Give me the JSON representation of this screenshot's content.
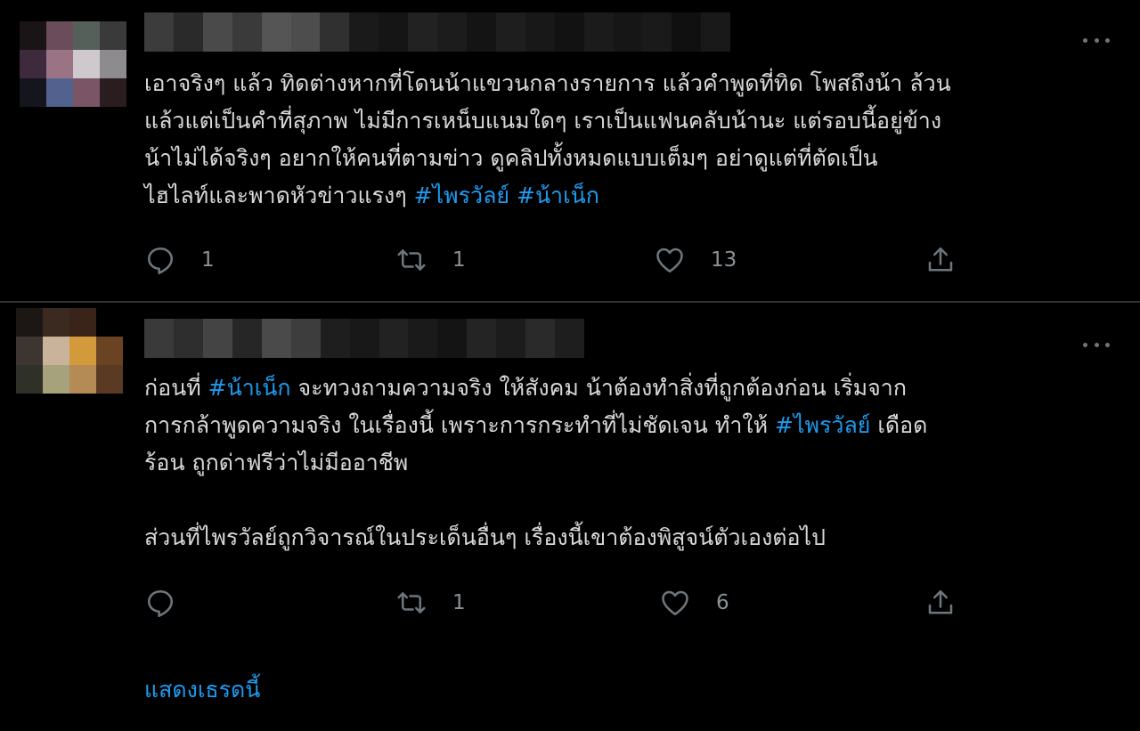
{
  "tweets": [
    {
      "lines": [
        [
          {
            "t": "เอาจริงๆ แล้ว ทิดต่างหากที่โดนน้าแขวนกลางรายการ แล้วคำพูดที่ทิด โพสถึงน้า ล้วน"
          }
        ],
        [
          {
            "t": "แล้วแต่เป็นคำที่สุภาพ ไม่มีการเหน็บแนมใดๆ เราเป็นแฟนคลับน้านะ แต่รอบนี้อยู่ข้าง"
          }
        ],
        [
          {
            "t": "น้าไม่ได้จริงๆ อยากให้คนที่ตามข่าว ดูคลิปทั้งหมดแบบเต็มๆ อย่าดูแต่ที่ตัดเป็น"
          }
        ],
        [
          {
            "t": "ไฮไลท์และพาดหัวข่าวแรงๆ "
          },
          {
            "t": "#ไพรวัลย์",
            "tag": true
          },
          {
            "t": " "
          },
          {
            "t": "#น้าเน็ก",
            "tag": true
          }
        ]
      ],
      "reply_count": "1",
      "retweet_count": "1",
      "like_count": "13"
    },
    {
      "lines": [
        [
          {
            "t": "ก่อนที่ "
          },
          {
            "t": "#น้าเน็ก",
            "tag": true
          },
          {
            "t": " จะทวงถามความจริง ให้สังคม น้าต้องทำสิ่งที่ถูกต้องก่อน เริ่มจาก"
          }
        ],
        [
          {
            "t": "การกล้าพูดความจริง ในเรื่องนี้  เพราะการกระทำที่ไม่ชัดเจน ทำให้ "
          },
          {
            "t": "#ไพรวัลย์",
            "tag": true
          },
          {
            "t": " เดือด"
          }
        ],
        [
          {
            "t": "ร้อน ถูกด่าฟรีว่าไม่มีออาชีพ"
          }
        ],
        [],
        [
          {
            "t": "ส่วนที่ไพรวัลย์ถูกวิจารณ์ในประเด็นอื่นๆ เรื่องนี้เขาต้องพิสูจน์ตัวเองต่อไป"
          }
        ]
      ],
      "reply_count": "",
      "retweet_count": "1",
      "like_count": "6"
    }
  ],
  "show_thread_label": "แสดงเธรดนี้",
  "colors": {
    "background": "#000000",
    "text": "#d9d9d9",
    "link": "#1d9bf0",
    "icon": "#6e767d",
    "divider": "#2f3336"
  },
  "icons": {
    "reply": "reply-icon",
    "retweet": "retweet-icon",
    "like": "heart-icon",
    "share": "share-icon",
    "more": "more-options-icon"
  }
}
